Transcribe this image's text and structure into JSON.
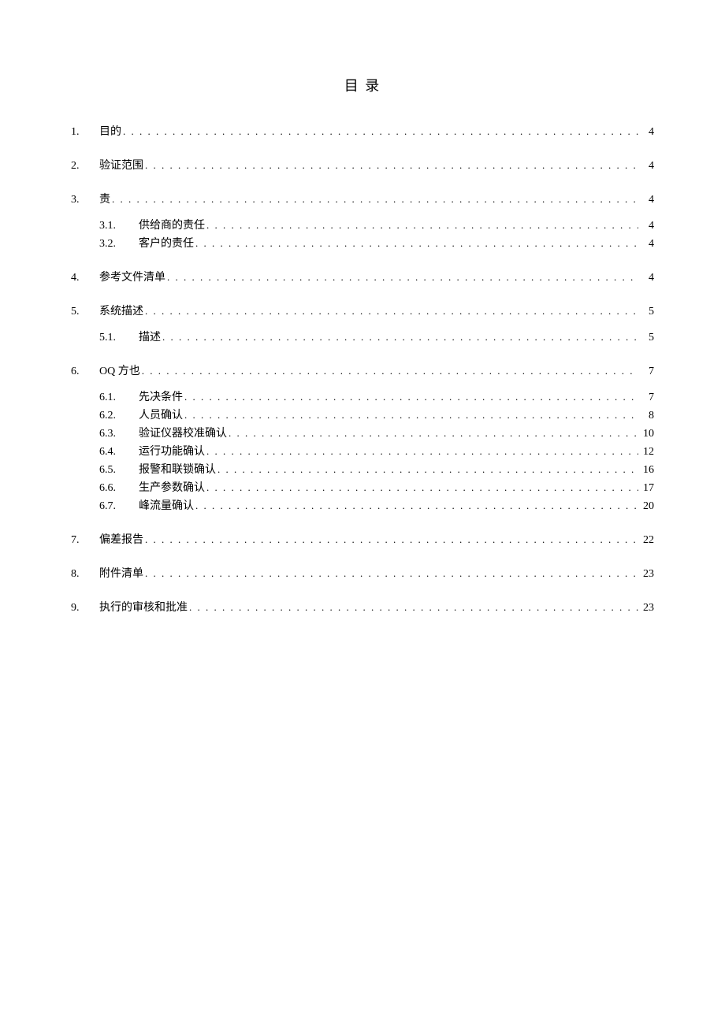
{
  "title": "目 录",
  "entries": [
    {
      "level": 1,
      "num": "1.",
      "label": "目的",
      "page": "4"
    },
    {
      "level": 1,
      "num": "2.",
      "label": "验证范围",
      "page": "4"
    },
    {
      "level": 1,
      "num": "3.",
      "label": "责",
      "page": "4"
    },
    {
      "level": 2,
      "num": "3.1.",
      "label": "供给商的责任",
      "page": "4",
      "group_start": true
    },
    {
      "level": 2,
      "num": "3.2.",
      "label": "客户的责任",
      "page": "4"
    },
    {
      "level": 1,
      "num": "4.",
      "label": "参考文件清单",
      "page": "4"
    },
    {
      "level": 1,
      "num": "5.",
      "label": "系统描述",
      "page": "5"
    },
    {
      "level": 2,
      "num": "5.1.",
      "label": "描述",
      "page": "5",
      "group_start": true
    },
    {
      "level": 1,
      "num": "6.",
      "label": "OQ 方也",
      "page": "7"
    },
    {
      "level": 2,
      "num": "6.1.",
      "label": "先决条件",
      "page": "7",
      "group_start": true
    },
    {
      "level": 2,
      "num": "6.2.",
      "label": "人员确认",
      "page": "8"
    },
    {
      "level": 2,
      "num": "6.3.",
      "label": "验证仪器校准确认",
      "page": "10"
    },
    {
      "level": 2,
      "num": "6.4.",
      "label": "运行功能确认",
      "page": "12"
    },
    {
      "level": 2,
      "num": "6.5.",
      "label": "报警和联锁确认",
      "page": "16"
    },
    {
      "level": 2,
      "num": "6.6.",
      "label": "生产参数确认",
      "page": "17"
    },
    {
      "level": 2,
      "num": "6.7.",
      "label": "峰流量确认",
      "page": "20"
    },
    {
      "level": 1,
      "num": "7.",
      "label": "偏差报告",
      "page": "22"
    },
    {
      "level": 1,
      "num": "8.",
      "label": "附件清单",
      "page": "23"
    },
    {
      "level": 1,
      "num": "9.",
      "label": "执行的审核和批准",
      "page": "23"
    }
  ]
}
